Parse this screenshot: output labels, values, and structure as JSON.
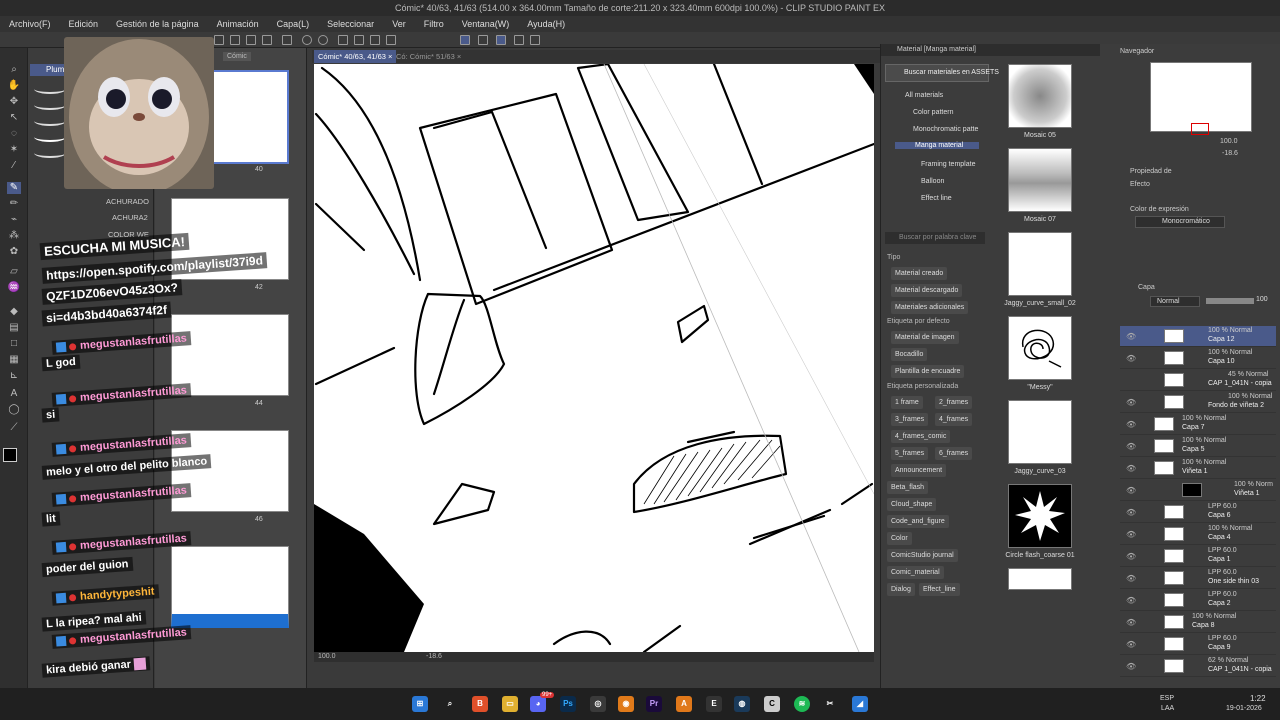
{
  "window": {
    "title": "Cómic* 40/63, 41/63 (514.00 x 364.00mm Tamaño de corte:211.20 x 323.40mm 600dpi 100.0%) - CLIP STUDIO PAINT EX"
  },
  "menu": [
    "Archivo(F)",
    "Edición",
    "Gestión de la página",
    "Animación",
    "Capa(L)",
    "Seleccionar",
    "Ver",
    "Filtro",
    "Ventana(W)",
    "Ayuda(H)"
  ],
  "subtool": {
    "tab": "Plumill",
    "brushes": [
      "ACHURADO",
      "ACHURA2",
      "COLOR WE"
    ]
  },
  "pages": {
    "tab2": "Cómic",
    "numbers": [
      "40",
      "42",
      "44",
      "46"
    ]
  },
  "canvas": {
    "tab_active": "Cómic* 40/63, 41/63",
    "tab_other": "Có: Cómic* 51/63",
    "zoom": "100.0",
    "angle": "-18.6"
  },
  "materials": {
    "panel_title": "Material [Manga material]",
    "search_button": "Buscar materiales en ASSETS",
    "tree": [
      "All materials",
      "Color pattern",
      "Monochromatic patte",
      "Manga material",
      "Framing template",
      "Balloon",
      "Effect line"
    ],
    "keyword_placeholder": "Buscar por palabra clave",
    "tipo_label": "Tipo",
    "tipo": [
      "Material creado",
      "Material descargado",
      "Materiales adicionales"
    ],
    "default_label": "Etiqueta por defecto",
    "default_tags": [
      "Material de imagen",
      "Bocadillo",
      "Plantilla de encuadre"
    ],
    "custom_label": "Etiqueta personalizada",
    "custom_tags": [
      "1 frame",
      "2_frames",
      "3_frames",
      "4_frames",
      "4_frames_comic",
      "5_frames",
      "6_frames",
      "Announcement",
      "Beta_flash",
      "Cloud_shape",
      "Code_and_figure",
      "Color",
      "ComicStudio journal",
      "Comic_material",
      "Dialog",
      "Effect_line"
    ],
    "items": [
      "Mosaic 05",
      "Mosaic 07",
      "Jaggy_curve_small_02",
      "\"Messy\"",
      "Jaggy_curve_03",
      "Circle flash_coarse 01"
    ]
  },
  "navigator": {
    "title": "Navegador",
    "zoom": "100.0",
    "angle": "-18.6"
  },
  "properties": {
    "title": "Propiedad de",
    "effect_label": "Efecto",
    "expression_label": "Color de expresión",
    "expression_value": "Monocromático"
  },
  "layers": {
    "title": "Capa",
    "blend": "Normal",
    "opacity": "100",
    "items": [
      {
        "mode": "100 % Normal",
        "name": "Capa 12"
      },
      {
        "mode": "100 % Normal",
        "name": "Capa 10"
      },
      {
        "mode": "45 % Normal",
        "name": "CAP 1_041N - copia"
      },
      {
        "mode": "100 % Normal",
        "name": "Fondo de viñeta 2"
      },
      {
        "mode": "100 % Normal",
        "name": "Capa 7"
      },
      {
        "mode": "100 % Normal",
        "name": "Capa 5"
      },
      {
        "mode": "100 % Normal",
        "name": "Viñeta 1"
      },
      {
        "mode": "100 % Norm",
        "name": "Viñeta 1"
      },
      {
        "mode": "LPP 60.0",
        "name": "Capa 6"
      },
      {
        "mode": "100 % Normal",
        "name": "Capa 4"
      },
      {
        "mode": "LPP 60.0",
        "name": "Capa 1"
      },
      {
        "mode": "LPP 60.0",
        "name": "One side thin 03"
      },
      {
        "mode": "LPP 60.0",
        "name": "Capa 2"
      },
      {
        "mode": "100 % Normal",
        "name": "Capa 8"
      },
      {
        "mode": "LPP 60.0",
        "name": "Capa 9"
      },
      {
        "mode": "62 % Normal",
        "name": "CAP 1_041N - copia"
      }
    ]
  },
  "chat": {
    "header": [
      "ESCUCHA MI MUSICA!",
      "https://open.spotify.com/playlist/37i9d",
      "QZF1DZ06evO45z3Ox?",
      "si=d4b3bd40a6374f2f"
    ],
    "messages": [
      {
        "user": "megustanlasfrutillas",
        "text": "L god"
      },
      {
        "user": "megustanlasfrutillas",
        "text": "si"
      },
      {
        "user": "megustanlasfrutillas",
        "text": "melo y el otro del pelito blanco"
      },
      {
        "user": "megustanlasfrutillas",
        "text": "lit"
      },
      {
        "user": "megustanlasfrutillas",
        "text": "poder del guion"
      },
      {
        "user": "handytypeshit",
        "text": "L la ripea? mal ahi"
      },
      {
        "user": "megustanlasfrutillas",
        "text": "kira debió ganar"
      }
    ]
  },
  "taskbar": {
    "lang1": "ESP",
    "lang2": "LAA",
    "time": "1:22",
    "date": "19-01-2026",
    "badge": "99+"
  }
}
